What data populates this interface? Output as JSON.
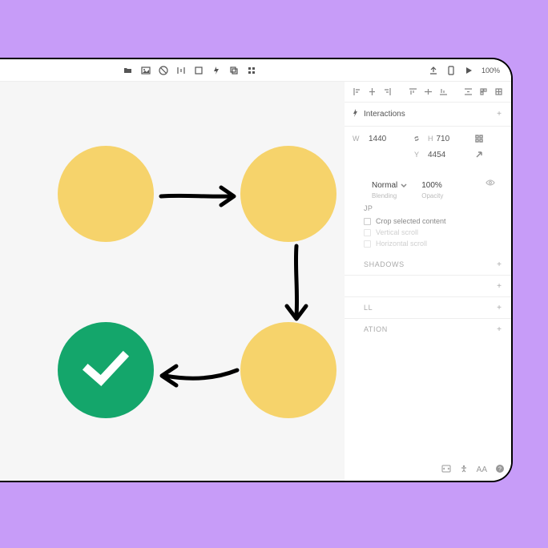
{
  "topbar": {
    "zoom": "100%"
  },
  "panel": {
    "interactions": {
      "title": "Interactions"
    },
    "dimensions": {
      "w_label": "W",
      "w_value": "1440",
      "h_label": "H",
      "h_value": "710",
      "y_label": "Y",
      "y_value": "4454"
    },
    "blending": {
      "mode": "Normal",
      "mode_label": "Blending",
      "opacity": "100%",
      "opacity_label": "Opacity"
    },
    "group": {
      "title": "JP",
      "crop": "Crop selected content",
      "vscroll": "Vertical scroll",
      "hscroll": "Horizontal scroll"
    },
    "shadows": {
      "title": "Shadows"
    },
    "fill": {
      "title": "LL"
    },
    "anim": {
      "title": "ATION"
    }
  },
  "footer": {
    "aa": "AA"
  }
}
